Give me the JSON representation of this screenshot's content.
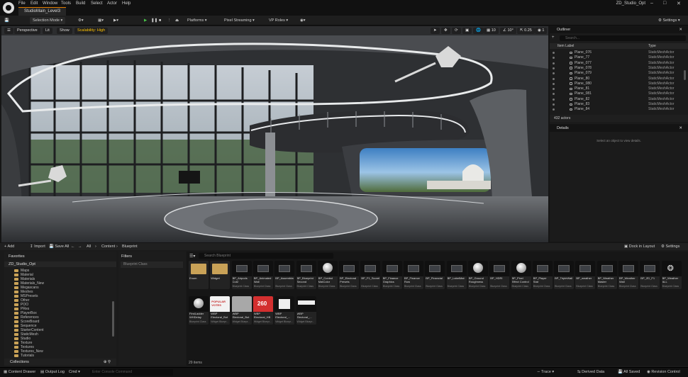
{
  "menu": [
    "File",
    "Edit",
    "Window",
    "Tools",
    "Build",
    "Select",
    "Actor",
    "Help"
  ],
  "project_tab": "StudioMain_Level3",
  "project_name": "ZD_Studio_Opt",
  "toolbar": {
    "selection_mode": "Selection Mode",
    "platforms": "Platforms",
    "pixel_streaming": "Pixel Streaming",
    "vp_roles": "VP Roles",
    "settings": "Settings"
  },
  "viewport": {
    "perspective": "Perspective",
    "lit": "Lit",
    "show": "Show",
    "scalability": "Scalability: High",
    "grid_snap": "10",
    "rot_snap": "10°",
    "scale_snap": "0.25",
    "cam_speed": "1"
  },
  "outliner": {
    "tab": "Outliner",
    "search_placeholder": "Search...",
    "col_label": "Item Label",
    "col_type": "Type",
    "rows": [
      {
        "label": "Plane_076",
        "type": "StaticMeshActor"
      },
      {
        "label": "Plane_77",
        "type": "StaticMeshActor"
      },
      {
        "label": "Plane_077",
        "type": "StaticMeshActor"
      },
      {
        "label": "Plane_078",
        "type": "StaticMeshActor"
      },
      {
        "label": "Plane_079",
        "type": "StaticMeshActor"
      },
      {
        "label": "Plane_80",
        "type": "StaticMeshActor"
      },
      {
        "label": "Plane_080",
        "type": "StaticMeshActor"
      },
      {
        "label": "Plane_81",
        "type": "StaticMeshActor"
      },
      {
        "label": "Plane_081",
        "type": "StaticMeshActor"
      },
      {
        "label": "Plane_82",
        "type": "StaticMeshActor"
      },
      {
        "label": "Plane_83",
        "type": "StaticMeshActor"
      },
      {
        "label": "Plane_84",
        "type": "StaticMeshActor"
      }
    ],
    "actor_count": "432 actors"
  },
  "details": {
    "tab": "Details",
    "empty_message": "Select an object to view details."
  },
  "content_browser": {
    "add": "Add",
    "import": "Import",
    "save_all": "Save All",
    "breadcrumb": [
      "All",
      "Content",
      "Blueprint"
    ],
    "dock": "Dock in Layout",
    "settings": "Settings",
    "favorites": "Favorites",
    "root": "ZD_Studio_Opt",
    "folders": [
      "Maps",
      "Material",
      "Materials",
      "Materials_New",
      "Megascans",
      "Meshes",
      "MSPresets",
      "Other",
      "POO",
      "PRes",
      "PlayerBox",
      "References",
      "ScoreBoard",
      "Sequence",
      "StarterContent",
      "StaticMesh",
      "Studio",
      "Texture",
      "Textures",
      "Textures_New",
      "Tutorials"
    ],
    "collections": "Collections",
    "filters_title": "Filters",
    "filter_item": "Blueprint Class",
    "search_placeholder": "Search Blueprint",
    "item_count": "29 items",
    "assets_row1": [
      {
        "name": "Enum",
        "sub": ""
      },
      {
        "name": "Widget",
        "sub": ""
      },
      {
        "name": "BP_Airpods Cut2",
        "sub": "Blueprint Class"
      },
      {
        "name": "BP_Animated Wall",
        "sub": "Blueprint Class"
      },
      {
        "name": "BP_Assembled",
        "sub": "Blueprint Class"
      },
      {
        "name": "BP_Blueprint Second",
        "sub": "Blueprint Class"
      },
      {
        "name": "BP_Control MatColor",
        "sub": "Blueprint Class"
      },
      {
        "name": "BP_Electoral Presets",
        "sub": "Blueprint Class"
      },
      {
        "name": "BP_F1_Scoreboard",
        "sub": "Blueprint Class"
      },
      {
        "name": "BP_Finance Graphics",
        "sub": "Blueprint Class"
      },
      {
        "name": "BP_Finance Row",
        "sub": "Blueprint Class"
      },
      {
        "name": "BP_Financial",
        "sub": "Blueprint Class"
      },
      {
        "name": "BP_LabelMat",
        "sub": "Blueprint Class"
      },
      {
        "name": "BP_Ground Roughness",
        "sub": "Blueprint Class"
      },
      {
        "name": "BP_HDRI",
        "sub": "Blueprint Class"
      },
      {
        "name": "BP_Pixel Effect Control",
        "sub": "Blueprint Class"
      },
      {
        "name": "BP_Player Stat",
        "sub": "Blueprint Class"
      },
      {
        "name": "BP_TripleWall",
        "sub": "Blueprint Class"
      },
      {
        "name": "BP_weather",
        "sub": "Blueprint Class"
      },
      {
        "name": "BP_Weather Master",
        "sub": "Blueprint Class"
      },
      {
        "name": "BP_Weather Wall",
        "sub": "Blueprint Class"
      },
      {
        "name": "BP_ZD_F1",
        "sub": "Blueprint Class"
      },
      {
        "name": "BP_Weather ALL",
        "sub": "Blueprint Class"
      }
    ],
    "assets_row2": [
      {
        "name": "FirstLadder WHDelay",
        "sub": "Blueprint Class"
      },
      {
        "name": "WBP Electoral_Bot",
        "sub": "Widget Bluepr..."
      },
      {
        "name": "WBP Electoral_Bot",
        "sub": "Widget Bluepr..."
      },
      {
        "name": "WBP Electoral_HB",
        "sub": "Widget Bluepr..."
      },
      {
        "name": "WBP Electoral_...",
        "sub": "Widget Bluepr..."
      },
      {
        "name": "WBP Electoral_...",
        "sub": "Widget Bluepr..."
      }
    ],
    "thumb_texts": {
      "popular": "POPULAR VOTES",
      "seats": "260"
    }
  },
  "status": {
    "content_drawer": "Content Drawer",
    "output_log": "Output Log",
    "cmd": "Cmd",
    "console_placeholder": "Enter Console Command",
    "trace": "Trace",
    "derived_data": "Derived Data",
    "all_saved": "All Saved",
    "revision_control": "Revision Control"
  }
}
